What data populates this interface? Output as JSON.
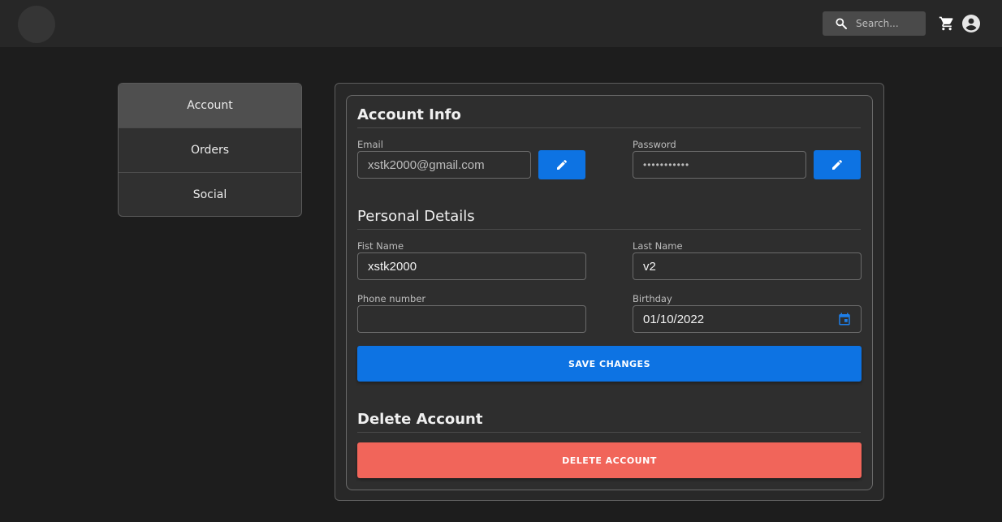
{
  "header": {
    "search_placeholder": "Search...",
    "icons": {
      "search": "search-icon",
      "cart": "cart-icon",
      "account": "account-circle-icon"
    }
  },
  "sidebar": {
    "items": [
      {
        "label": "Account",
        "active": true
      },
      {
        "label": "Orders",
        "active": false
      },
      {
        "label": "Social",
        "active": false
      }
    ]
  },
  "account_info": {
    "title": "Account Info",
    "email_label": "Email",
    "email_value": "xstk2000@gmail.com",
    "password_label": "Password",
    "password_value": "•••••••••••"
  },
  "personal_details": {
    "title": "Personal Details",
    "first_name_label": "Fist Name",
    "first_name_value": "xstk2000",
    "last_name_label": "Last Name",
    "last_name_value": "v2",
    "phone_label": "Phone number",
    "phone_value": "",
    "birthday_label": "Birthday",
    "birthday_value": "01/10/2022",
    "save_label": "SAVE CHANGES"
  },
  "delete_account": {
    "title": "Delete Account",
    "button_label": "DELETE ACCOUNT"
  },
  "colors": {
    "primary": "#0d73e3",
    "danger": "#f1655a",
    "background": "#1d1d1d",
    "topbar": "#272727"
  }
}
